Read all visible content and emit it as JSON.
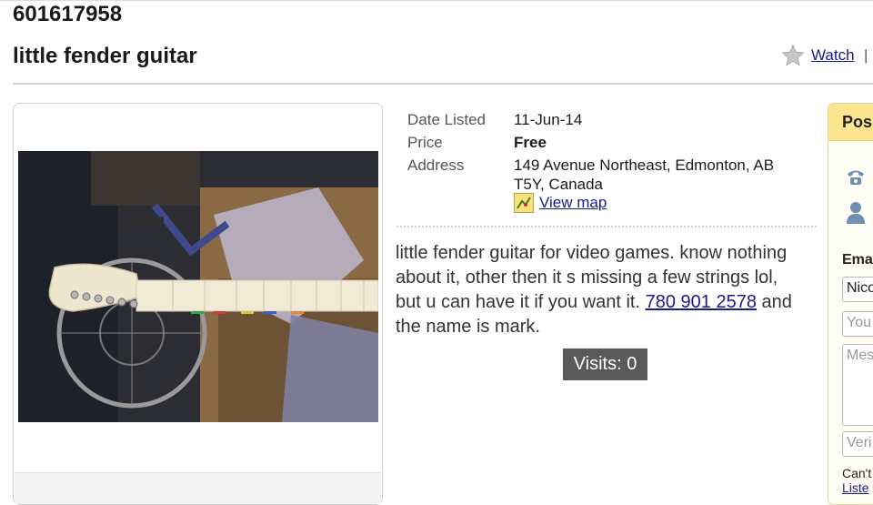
{
  "header": {
    "ad_id": "601617958",
    "title": "little fender guitar",
    "watch_label": "Watch",
    "separator": "|"
  },
  "details": {
    "date_label": "Date Listed",
    "date_value": "11-Jun-14",
    "price_label": "Price",
    "price_value": "Free",
    "address_label": "Address",
    "address_line1": "149 Avenue Northeast, Edmonton, AB",
    "address_line2": "T5Y, Canada",
    "map_link": "View map"
  },
  "description": {
    "text_before": "little fender guitar for video games. know nothing about it, other then it s missing a few strings lol, but u can have it if you want it. ",
    "phone": "780 901 2578",
    "text_after": " and the name is mark."
  },
  "visits": "Visits: 0",
  "side_panel": {
    "header": "Pos",
    "email_label": "Ema",
    "name_value": "Nico",
    "email_placeholder": "You",
    "message_placeholder": "Mes",
    "verify_placeholder": "Veri",
    "note": "Can't",
    "link": "Liste"
  },
  "icons": {
    "watch": "star-icon",
    "map": "map-icon",
    "phone": "phone-icon",
    "person": "person-icon"
  }
}
